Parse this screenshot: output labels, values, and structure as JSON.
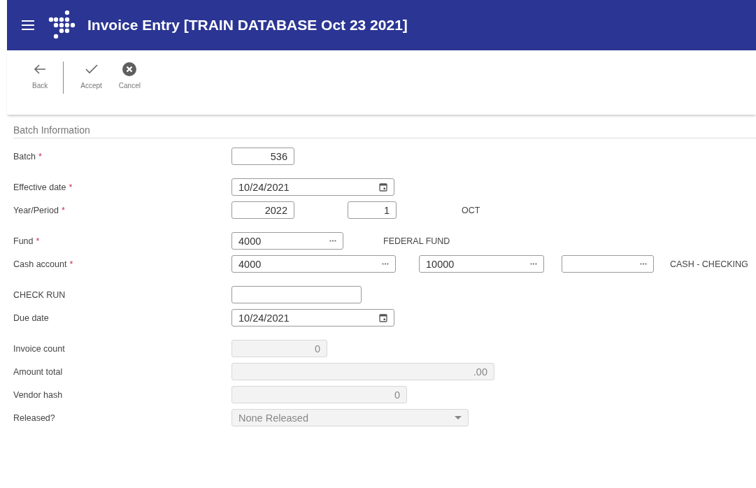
{
  "window": {
    "title": "Invoice Entry [TRAIN DATABASE Oct 23 2021]"
  },
  "toolbar": [
    {
      "kind": "back",
      "label": "Back"
    },
    {
      "kind": "accept",
      "label": "Accept"
    },
    {
      "kind": "cancel",
      "label": "Cancel"
    }
  ],
  "section": {
    "title": "Batch Information"
  },
  "groups": [
    [
      {
        "label": "Batch",
        "marker": "*",
        "fields": [
          {
            "kind": "number",
            "value": "536",
            "disabled": false
          }
        ]
      }
    ],
    [
      {
        "label": "Effective date",
        "marker": "*",
        "fields": [
          {
            "kind": "date",
            "value": "10/24/2021",
            "disabled": false
          }
        ]
      },
      {
        "label": "Year/Period",
        "marker": "*",
        "fields": [
          {
            "kind": "number",
            "value": "2022",
            "disabled": false
          },
          {
            "kind": "number",
            "value": "1",
            "disabled": false
          },
          {
            "kind": "note",
            "value": "OCT"
          }
        ]
      }
    ],
    [
      {
        "label": "Fund",
        "marker": "*",
        "fields": [
          {
            "kind": "lookup",
            "value": "4000",
            "disabled": false
          },
          {
            "kind": "note",
            "value": "FEDERAL FUND"
          }
        ]
      },
      {
        "label": "Cash account",
        "marker": "*",
        "fields": [
          {
            "kind": "lookup",
            "value": "4000",
            "disabled": false
          },
          {
            "kind": "lookup",
            "value": "10000",
            "disabled": false
          },
          {
            "kind": "lookup",
            "disabled": false
          },
          {
            "kind": "note",
            "value": "CASH - CHECKING"
          }
        ]
      }
    ],
    [
      {
        "label": "CHECK RUN",
        "fields": [
          {
            "kind": "text",
            "disabled": false
          }
        ]
      },
      {
        "label": "Due date",
        "fields": [
          {
            "kind": "date",
            "value": "10/24/2021",
            "disabled": false
          }
        ]
      }
    ],
    [
      {
        "label": "Invoice count",
        "fields": [
          {
            "kind": "number",
            "value": "0",
            "disabled": true
          }
        ]
      },
      {
        "label": "Amount total",
        "fields": [
          {
            "kind": "number",
            "value": ".00",
            "disabled": true
          }
        ]
      },
      {
        "label": "Vendor hash",
        "fields": [
          {
            "kind": "number",
            "value": "0",
            "disabled": true
          }
        ]
      },
      {
        "label": "Released?",
        "fields": [
          {
            "kind": "select",
            "value": "None Released",
            "disabled": true
          }
        ]
      }
    ]
  ]
}
